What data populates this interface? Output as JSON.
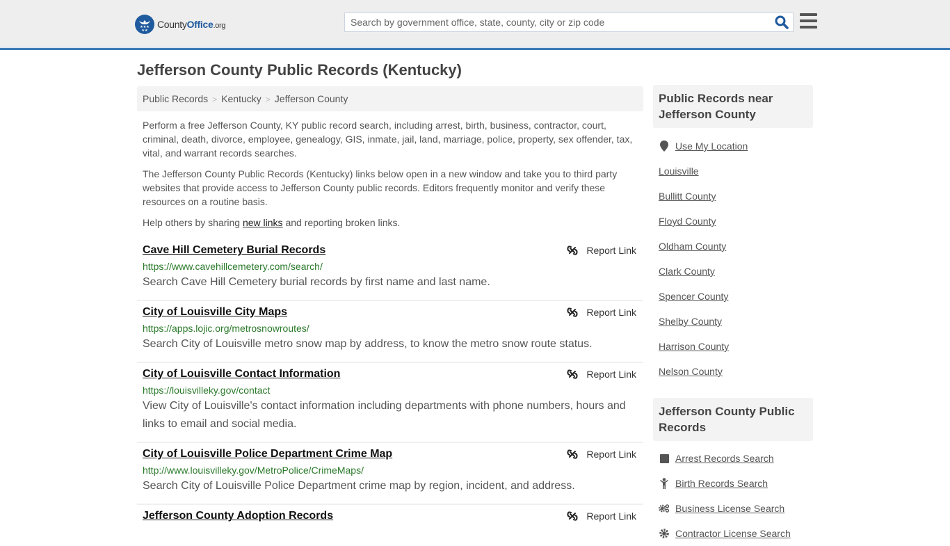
{
  "header": {
    "logo": {
      "brand_main": "County",
      "brand_accent": "Office",
      "brand_tld": ".org"
    },
    "search": {
      "placeholder": "Search by government office, state, county, city or zip code",
      "value": ""
    },
    "icons": {
      "search": "search-icon",
      "menu": "hamburger-menu-icon"
    }
  },
  "page": {
    "title": "Jefferson County Public Records (Kentucky)",
    "breadcrumb": [
      {
        "label": "Public Records"
      },
      {
        "label": "Kentucky"
      },
      {
        "label": "Jefferson County"
      }
    ],
    "breadcrumb_separator": ">",
    "intro": {
      "p1": "Perform a free Jefferson County, KY public record search, including arrest, birth, business, contractor, court, criminal, death, divorce, employee, genealogy, GIS, inmate, jail, land, marriage, police, property, sex offender, tax, vital, and warrant records searches.",
      "p2": "The Jefferson County Public Records (Kentucky) links below open in a new window and take you to third party websites that provide access to Jefferson County public records. Editors frequently monitor and verify these resources on a routine basis.",
      "p3_before": "Help others by sharing ",
      "p3_link": "new links",
      "p3_after": " and reporting broken links."
    }
  },
  "records": [
    {
      "title": "Cave Hill Cemetery Burial Records",
      "url": "https://www.cavehillcemetery.com/search/",
      "description": "Search Cave Hill Cemetery burial records by first name and last name.",
      "report_label": "Report Link"
    },
    {
      "title": "City of Louisville City Maps",
      "url": "https://apps.lojic.org/metrosnowroutes/",
      "description": "Search City of Louisville metro snow map by address, to know the metro snow route status.",
      "report_label": "Report Link"
    },
    {
      "title": "City of Louisville Contact Information",
      "url": "https://louisvilleky.gov/contact",
      "description": "View City of Louisville's contact information including departments with phone numbers, hours and links to email and social media.",
      "report_label": "Report Link"
    },
    {
      "title": "City of Louisville Police Department Crime Map",
      "url": "http://www.louisvilleky.gov/MetroPolice/CrimeMaps/",
      "description": "Search City of Louisville Police Department crime map by region, incident, and address.",
      "report_label": "Report Link"
    },
    {
      "title": "Jefferson County Adoption Records",
      "url": "",
      "description": "",
      "report_label": "Report Link"
    }
  ],
  "sidebar": {
    "nearby": {
      "heading": "Public Records near Jefferson County",
      "use_location": "Use My Location",
      "items": [
        "Louisville",
        "Bullitt County",
        "Floyd County",
        "Oldham County",
        "Clark County",
        "Spencer County",
        "Shelby County",
        "Harrison County",
        "Nelson County"
      ]
    },
    "county_records": {
      "heading": "Jefferson County Public Records",
      "items": [
        {
          "label": "Arrest Records Search",
          "icon": "square-icon"
        },
        {
          "label": "Birth Records Search",
          "icon": "child-icon"
        },
        {
          "label": "Business License Search",
          "icon": "gears-icon"
        },
        {
          "label": "Contractor License Search",
          "icon": "gear-icon"
        }
      ]
    }
  },
  "colors": {
    "brand_blue": "#1f5a9e",
    "header_border": "#3b7bb5",
    "url_green": "#2b7a2b",
    "header_bg": "#eeeeee"
  }
}
